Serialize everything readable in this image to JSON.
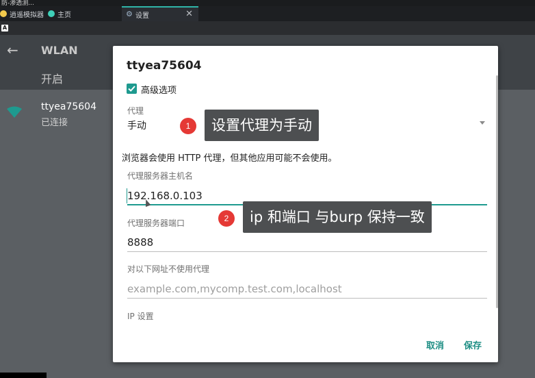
{
  "window": {
    "title": "防-渗透测..."
  },
  "tabs": [
    {
      "label": "逍遥模拟器",
      "icon": "app-icon"
    },
    {
      "label": "主页",
      "icon": "home-icon"
    },
    {
      "label": "设置",
      "icon": "gear-icon",
      "close": "✕"
    }
  ],
  "android": {
    "back": "←",
    "title": "WLAN",
    "toggle_label": "开启",
    "network": {
      "ssid": "ttyea75604",
      "status": "已连接"
    }
  },
  "dialog": {
    "title": "ttyea75604",
    "advanced_label": "高级选项",
    "advanced_checked": true,
    "proxy_label": "代理",
    "proxy_value": "手动",
    "warning": "浏览器会使用 HTTP 代理，但其他应用可能不会使用。",
    "host_label": "代理服务器主机名",
    "host_value": "192.168.0.103",
    "port_label": "代理服务器端口",
    "port_value": "8888",
    "bypass_label": "对以下网址不使用代理",
    "bypass_placeholder": "example.com,mycomp.test.com,localhost",
    "ip_label": "IP 设置",
    "cancel_label": "取消",
    "save_label": "保存"
  },
  "annotations": [
    {
      "number": "1",
      "text": "设置代理为手动"
    },
    {
      "number": "2",
      "text": "ip 和端口 与burp 保持一致"
    }
  ],
  "colors": {
    "accent": "#1e9a8f",
    "badge": "#e53935",
    "callout_bg": "#4d4f51"
  }
}
